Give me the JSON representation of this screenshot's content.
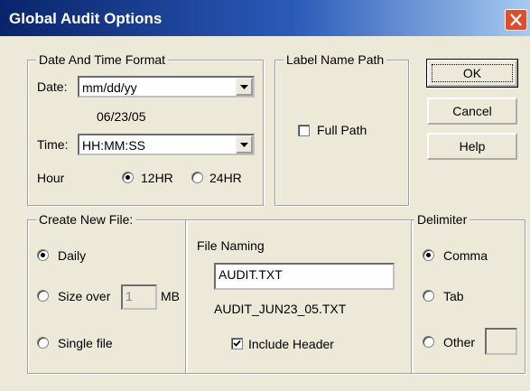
{
  "window": {
    "title": "Global Audit Options"
  },
  "date_time": {
    "legend": "Date And Time Format",
    "date_label": "Date:",
    "date_value": "mm/dd/yy",
    "date_preview": "06/23/05",
    "time_label": "Time:",
    "time_value": "HH:MM:SS",
    "hour_label": "Hour",
    "hour_12": "12HR",
    "hour_24": "24HR",
    "hour_selected": "12HR"
  },
  "label_name_path": {
    "legend": "Label Name Path",
    "full_path_label": "Full Path",
    "full_path_checked": false
  },
  "buttons": {
    "ok": "OK",
    "cancel": "Cancel",
    "help": "Help"
  },
  "create_new_file": {
    "legend": "Create New File:",
    "daily": "Daily",
    "size_over": "Size over",
    "size_value": "1",
    "size_unit": "MB",
    "single_file": "Single file",
    "selected": "Daily"
  },
  "file_naming": {
    "label": "File Naming",
    "filename": "AUDIT.TXT",
    "preview": "AUDIT_JUN23_05.TXT",
    "include_header": "Include Header",
    "include_header_checked": true
  },
  "delimiter": {
    "legend": "Delimiter",
    "comma": "Comma",
    "tab": "Tab",
    "other": "Other",
    "other_value": "",
    "selected": "Comma"
  }
}
